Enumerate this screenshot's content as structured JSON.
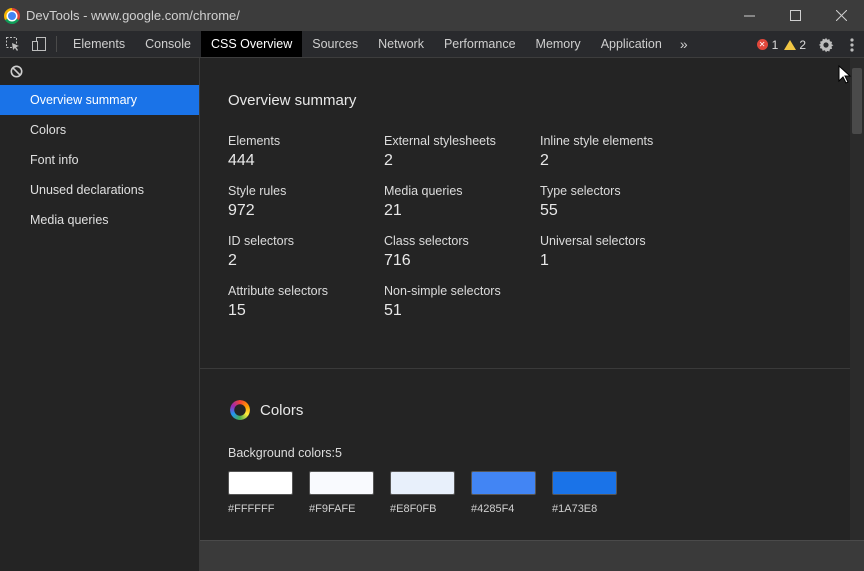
{
  "window": {
    "title": "DevTools - www.google.com/chrome/",
    "controls": {
      "minimize": "—",
      "maximize": "☐",
      "close": "✕"
    }
  },
  "toolbar": {
    "tabs": [
      {
        "label": "Elements"
      },
      {
        "label": "Console"
      },
      {
        "label": "CSS Overview",
        "active": true
      },
      {
        "label": "Sources"
      },
      {
        "label": "Network"
      },
      {
        "label": "Performance"
      },
      {
        "label": "Memory"
      },
      {
        "label": "Application"
      }
    ],
    "more_tabs": "»",
    "errors_count": "1",
    "warnings_count": "2"
  },
  "sidebar": {
    "items": [
      {
        "label": "Overview summary",
        "active": true
      },
      {
        "label": "Colors"
      },
      {
        "label": "Font info"
      },
      {
        "label": "Unused declarations"
      },
      {
        "label": "Media queries"
      }
    ]
  },
  "overview": {
    "title": "Overview summary",
    "stats": [
      {
        "label": "Elements",
        "value": "444"
      },
      {
        "label": "External stylesheets",
        "value": "2"
      },
      {
        "label": "Inline style elements",
        "value": "2"
      },
      {
        "label": "Style rules",
        "value": "972"
      },
      {
        "label": "Media queries",
        "value": "21"
      },
      {
        "label": "Type selectors",
        "value": "55"
      },
      {
        "label": "ID selectors",
        "value": "2"
      },
      {
        "label": "Class selectors",
        "value": "716"
      },
      {
        "label": "Universal selectors",
        "value": "1"
      },
      {
        "label": "Attribute selectors",
        "value": "15"
      },
      {
        "label": "Non-simple selectors",
        "value": "51"
      }
    ]
  },
  "colors": {
    "title": "Colors",
    "background_label": "Background colors:5",
    "background_colors": [
      "#FFFFFF",
      "#F9FAFE",
      "#E8F0FB",
      "#4285F4",
      "#1A73E8"
    ]
  },
  "accent_color": "#1A73E8"
}
